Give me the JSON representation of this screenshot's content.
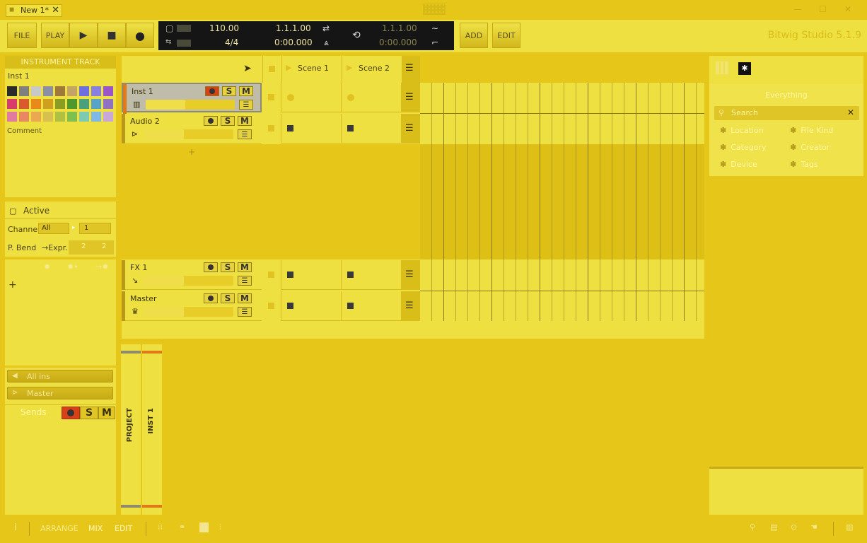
{
  "window": {
    "tab_label": "New 1*",
    "tab_close": "✕",
    "minimize": "—",
    "maximize": "☐",
    "close": "✕",
    "brand": "Bitwig Studio 5.1.9"
  },
  "toolbar": {
    "file": "FILE",
    "play": "PLAY",
    "play_icon": "▶",
    "stop_icon": "■",
    "record_icon": "●",
    "add": "ADD",
    "edit": "EDIT"
  },
  "transport": {
    "tempo": "110.00",
    "signature": "4/4",
    "position_bars": "1.1.1.00",
    "position_time": "0:00.000",
    "loop_bars": "1.1.1.00",
    "loop_time": "0:00.000"
  },
  "inspector": {
    "header": "INSTRUMENT TRACK",
    "track_name": "Inst 1",
    "comment": "Comment",
    "active_label": "Active",
    "channel_label": "Channel",
    "channel_value": "All",
    "channel_num": "1",
    "pbend_label": "P. Bend",
    "expr_label": "→Expr.",
    "pbend_val1": "2",
    "pbend_val2": "2",
    "plus": "+",
    "input_label": "All ins",
    "output_label": "Master",
    "sends_label": "Sends",
    "s_label": "S",
    "m_label": "M"
  },
  "swatches": [
    "#2b2b2b",
    "#7f7f7f",
    "#c8c8c8",
    "#8a8ea6",
    "#a0793a",
    "#c3a465",
    "#6d6ee0",
    "#8880e0",
    "#9a54c8",
    "#d83a6c",
    "#d85a2e",
    "#e8891a",
    "#cfa020",
    "#8a9c22",
    "#4c9a2e",
    "#4aa07a",
    "#58a4c8",
    "#9070c0",
    "#e07aa0",
    "#e88860",
    "#eaa850",
    "#d8c050",
    "#b0c040",
    "#7ec050",
    "#7ecab0",
    "#80b8e8",
    "#c8a8d8"
  ],
  "tracks": [
    {
      "name": "Inst 1",
      "s": "S",
      "m": "M",
      "color": "#e07a18"
    },
    {
      "name": "Audio 2",
      "s": "S",
      "m": "M",
      "color": "#b89a18"
    },
    {
      "name": "FX 1",
      "s": "S",
      "m": "M",
      "color": "#b89a18"
    },
    {
      "name": "Master",
      "s": "S",
      "m": "M",
      "color": "#b89a18"
    }
  ],
  "scenes": [
    "Scene 1",
    "Scene 2"
  ],
  "add_track": "+",
  "browser": {
    "title": "Everything",
    "search_placeholder": "Search",
    "search_clear": "✕",
    "filters": [
      "Location",
      "File Kind",
      "Category",
      "Creator",
      "Device",
      "Tags"
    ]
  },
  "mixer": {
    "project": "PROJECT",
    "inst1": "INST 1"
  },
  "bottom": {
    "info": "i",
    "arrange": "ARRANGE",
    "mix": "MIX",
    "edit": "EDIT"
  }
}
